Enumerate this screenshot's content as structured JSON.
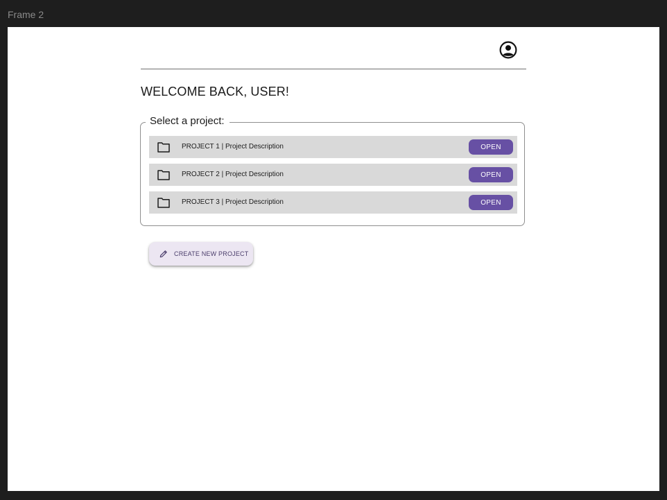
{
  "frame": {
    "label": "Frame 2"
  },
  "header": {
    "avatar_icon": "account-circle-icon"
  },
  "welcome": {
    "text": "WELCOME BACK, USER!"
  },
  "projects": {
    "legend": "Select a project:",
    "items": [
      {
        "label": "PROJECT 1 | Project Description",
        "button": "OPEN",
        "icon": "folder-icon"
      },
      {
        "label": "PROJECT 2 | Project Description",
        "button": "OPEN",
        "icon": "folder-icon"
      },
      {
        "label": "PROJECT 3 | Project Description",
        "button": "OPEN",
        "icon": "folder-icon"
      }
    ]
  },
  "create": {
    "label": "CREATE NEW PROJECT",
    "icon": "pencil-icon"
  },
  "colors": {
    "canvas": "#1e1e1e",
    "frame": "#ffffff",
    "row": "#d9d9d9",
    "primary": "#6750a4",
    "create_bg": "#ece6f2"
  }
}
